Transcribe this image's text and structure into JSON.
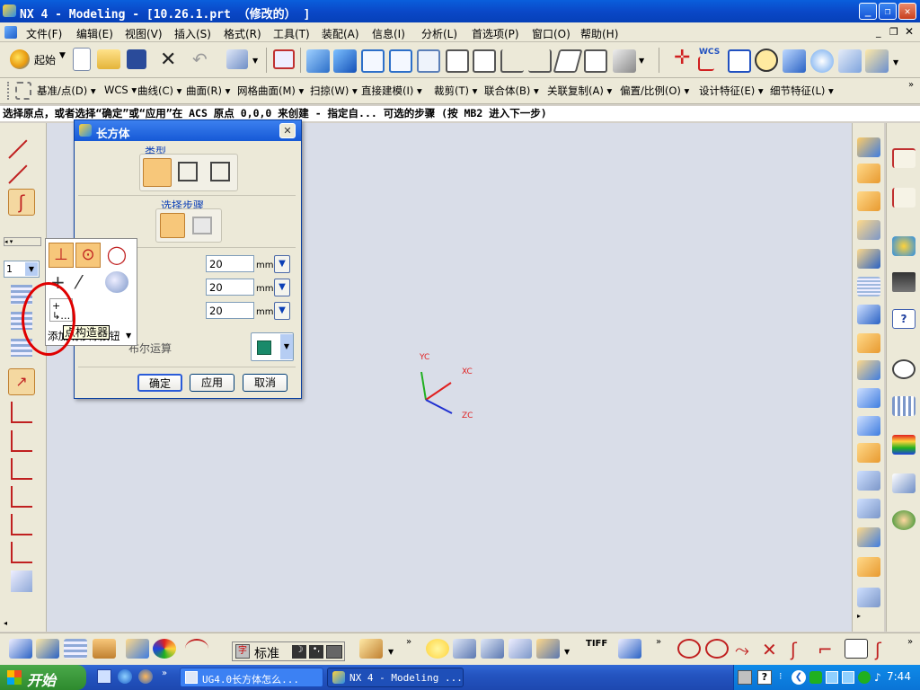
{
  "window": {
    "title": "NX 4 - Modeling - [10.26.1.prt （修改的） ]"
  },
  "menubar": {
    "items": [
      "文件(F)",
      "编辑(E)",
      "视图(V)",
      "插入(S)",
      "格式(R)",
      "工具(T)",
      "装配(A)",
      "信息(I)",
      "分析(L)",
      "首选项(P)",
      "窗口(O)",
      "帮助(H)"
    ]
  },
  "toolbar1": {
    "start_label": "起始"
  },
  "toolbar2": {
    "items": [
      "基准/点(D)",
      "WCS",
      "曲线(C)",
      "曲面(R)",
      "网格曲面(M)",
      "扫掠(W)",
      "直接建模(I)",
      "裁剪(T)",
      "联合体(B)",
      "关联复制(A)",
      "偏置/比例(O)",
      "设计特征(E)",
      "细节特征(L)"
    ]
  },
  "status_line": "选择原点，或者选择“确定”或“应用”在 ACS 原点 0,0,0 来创建 - 指定自...  可选的步骤 (按 MB2 进入下一步)",
  "left_toolbar": {
    "layer_value": "1"
  },
  "dialog": {
    "title": "长方体",
    "type_label": "类型",
    "steps_label": "选择步骤",
    "length": "20",
    "width": "20",
    "height": "20",
    "unit": "mm",
    "boolean_label": "布尔运算",
    "ok": "确定",
    "apply": "应用",
    "cancel": "取消"
  },
  "popup": {
    "add_remove_label": "添加或移除按钮",
    "tooltip": "点构造器"
  },
  "axes": {
    "x": "XC",
    "y": "YC",
    "z": "ZC"
  },
  "bottom_toolbar": {
    "ime_label": "标准",
    "tiff_label": "TIFF"
  },
  "taskbar": {
    "start": "开始",
    "tasks": [
      "UG4.0长方体怎么...",
      "NX 4 - Modeling ..."
    ],
    "clock": "7:44"
  },
  "colors": {
    "canvas": "#d9dde8",
    "title_blue": "#0a48c8",
    "highlight": "#e00000"
  }
}
